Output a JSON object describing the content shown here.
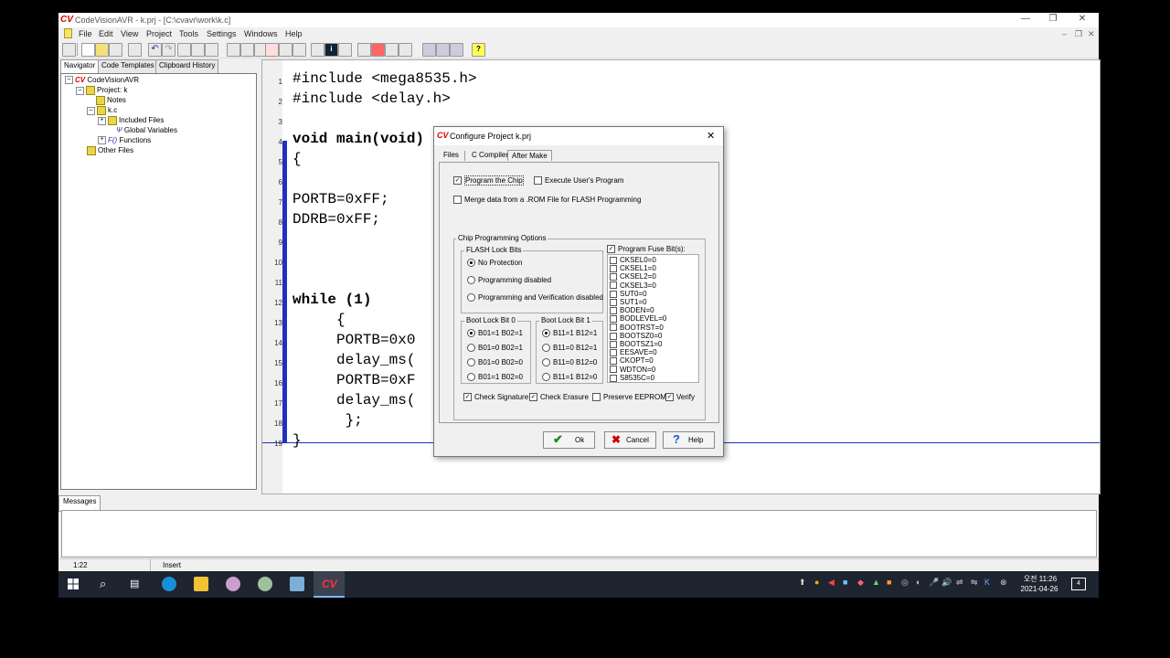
{
  "window": {
    "logo": "CV",
    "title": "CodeVisionAVR - k.prj - [C:\\cvavr\\work\\k.c]"
  },
  "menu": [
    "File",
    "Edit",
    "View",
    "Project",
    "Tools",
    "Settings",
    "Windows",
    "Help"
  ],
  "navigator": {
    "tabs": [
      "Navigator",
      "Code Templates",
      "Clipboard History"
    ],
    "tree": {
      "root": "CodeVisionAVR",
      "project": "Project: k",
      "notes": "Notes",
      "file": "k.c",
      "included": "Included Files",
      "globals": "Global Variables",
      "functions": "Functions",
      "other": "Other Files"
    }
  },
  "editor": {
    "line_numbers": [
      "1",
      "2",
      "3",
      "4",
      "5",
      "6",
      "7",
      "8",
      "9",
      "10",
      "11",
      "12",
      "13",
      "14",
      "15",
      "16",
      "17",
      "18",
      "19"
    ],
    "lines": [
      "#include <mega8535.h>",
      "#include <delay.h>",
      "",
      "void main(void)",
      "{",
      "",
      "PORTB=0xFF;",
      "DDRB=0xFF;",
      "",
      "",
      "",
      "while (1)",
      "     {",
      "     PORTB=0x0",
      "     delay_ms(",
      "     PORTB=0xF",
      "     delay_ms(",
      "      };",
      "}"
    ]
  },
  "messages": {
    "tab": "Messages"
  },
  "statusbar": {
    "position": "1:22",
    "mode": "Insert"
  },
  "taskbar": {
    "time": "오전 11:26",
    "date": "2021-04-26",
    "notifications": "4"
  },
  "dialog": {
    "title": "Configure Project k.prj",
    "tabs": [
      "Files",
      "C Compiler",
      "After Make"
    ],
    "program_chip": "Program the Chip",
    "execute_user": "Execute User's Program",
    "merge_data": "Merge data from a .ROM File for FLASH Programming",
    "options_title": "Chip Programming Options",
    "flash_lock": {
      "title": "FLASH Lock Bits",
      "options": [
        "No Protection",
        "Programming disabled",
        "Programming and Verification disabled"
      ],
      "selected": 0
    },
    "boot0": {
      "title": "Boot Lock Bit 0",
      "options": [
        "B01=1 B02=1",
        "B01=0 B02=1",
        "B01=0 B02=0",
        "B01=1 B02=0"
      ],
      "selected": 0
    },
    "boot1": {
      "title": "Boot Lock Bit 1",
      "options": [
        "B11=1 B12=1",
        "B11=0 B12=1",
        "B11=0 B12=0",
        "B11=1 B12=0"
      ],
      "selected": 0
    },
    "program_fuse": "Program Fuse Bit(s):",
    "fuses": [
      "CKSEL0=0",
      "CKSEL1=0",
      "CKSEL2=0",
      "CKSEL3=0",
      "SUT0=0",
      "SUT1=0",
      "BODEN=0",
      "BODLEVEL=0",
      "BOOTRST=0",
      "BOOTSZ0=0",
      "BOOTSZ1=0",
      "EESAVE=0",
      "CKOPT=0",
      "WDTON=0",
      "S8535C=0"
    ],
    "check_signature": "Check Signature",
    "check_erasure": "Check Erasure",
    "preserve_eeprom": "Preserve EEPROM",
    "verify": "Verify",
    "ok": "Ok",
    "cancel": "Cancel",
    "help": "Help"
  }
}
